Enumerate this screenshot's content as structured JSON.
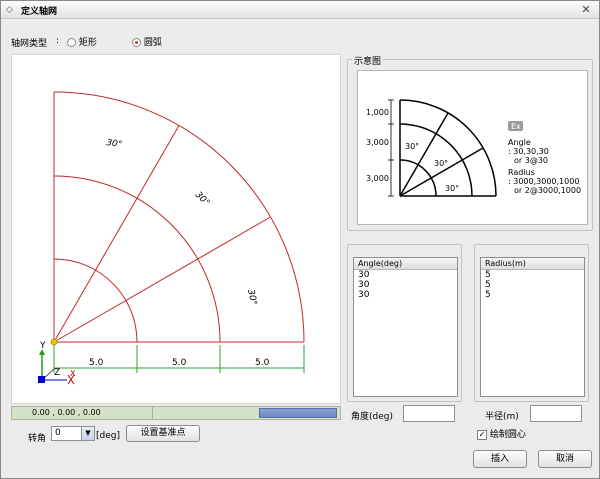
{
  "window": {
    "title": "定义轴网"
  },
  "grid_type": {
    "label": "轴网类型",
    "colon": ":",
    "options": [
      "矩形",
      "圆弧"
    ],
    "selected": "圆弧"
  },
  "canvas": {
    "sector_angles": [
      "30°",
      "30°",
      "30°"
    ],
    "dimensions": [
      "5.0",
      "5.0",
      "5.0"
    ],
    "axes": {
      "y": "Y",
      "z": "Z",
      "x": "X"
    },
    "colors": {
      "grid": "#c0282a",
      "dimension": "#2ea52e",
      "y_axis": "#1f9d1f",
      "x_axis": "#0000cc",
      "highlight": "#e8c000"
    }
  },
  "status": {
    "coords": "0.00 , 0.00 , 0.00"
  },
  "rotation": {
    "label": "转角",
    "value": "0",
    "unit": "[deg]",
    "set_base_point_label": "设置基准点"
  },
  "schematic": {
    "label": "示意图",
    "dims": [
      "1,000",
      "3,000",
      "3,000"
    ],
    "angles": [
      "30°",
      "30°",
      "30°"
    ],
    "ex_label": "Ex",
    "angle_title": "Angle",
    "angle_example": ": 30,30,30",
    "angle_or": "or 3@30",
    "radius_title": "Radius",
    "radius_example": ": 3000,3000,1000",
    "radius_or": "or 2@3000,1000"
  },
  "angle_list": {
    "header": "Angle(deg)",
    "items": [
      "30",
      "30",
      "30"
    ]
  },
  "radius_list": {
    "header": "Radius(m)",
    "items": [
      "5",
      "5",
      "5"
    ]
  },
  "angle_input": {
    "label": "角度(deg)",
    "value": ""
  },
  "radius_input": {
    "label": "半径(m)",
    "value": ""
  },
  "draw_center": {
    "label": "绘制圆心",
    "checked": true
  },
  "buttons": {
    "insert": "插入",
    "cancel": "取消"
  }
}
